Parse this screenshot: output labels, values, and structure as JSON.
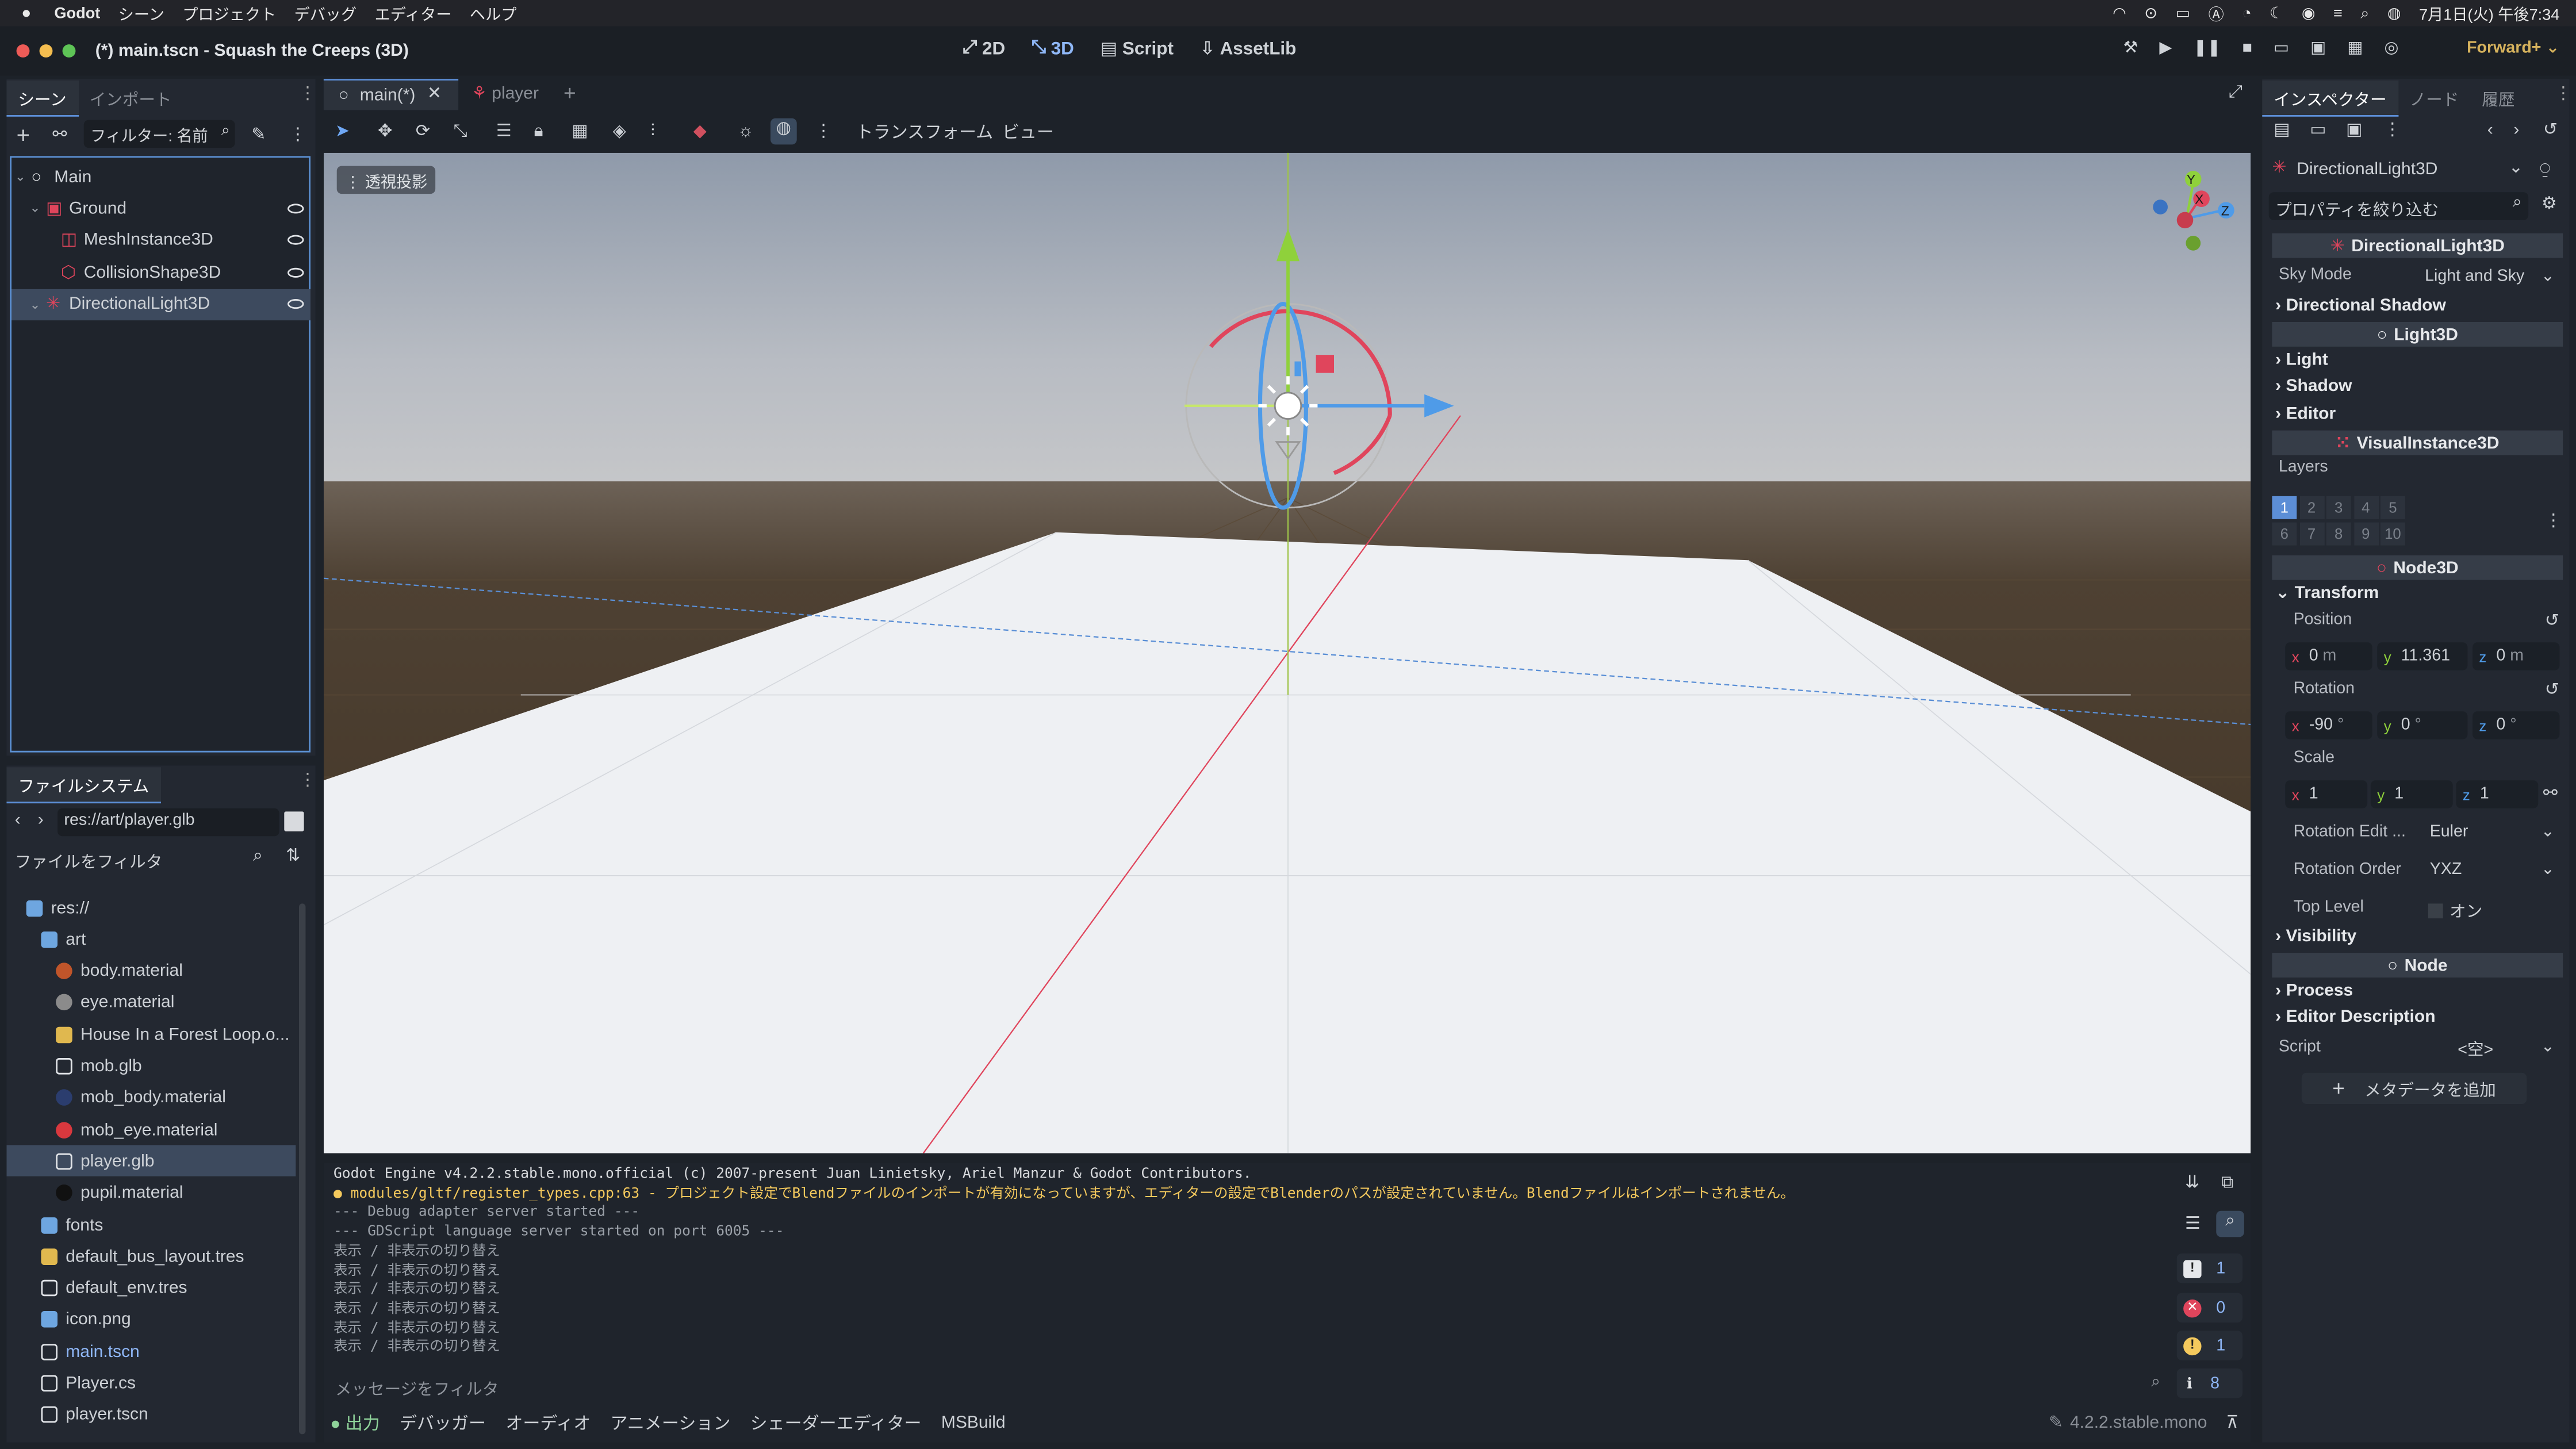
{
  "menubar": {
    "app": "Godot",
    "items": [
      "シーン",
      "プロジェクト",
      "デバッグ",
      "エディター",
      "ヘルプ"
    ],
    "clock": "7月1日(火) 午後7:34"
  },
  "window": {
    "title": "(*) main.tscn - Squash the Creeps (3D)",
    "main_tabs": [
      "2D",
      "3D",
      "Script",
      "AssetLib"
    ],
    "active_main_tab": "3D",
    "renderer": "Forward+"
  },
  "scene_dock": {
    "tabs": [
      "シーン",
      "インポート"
    ],
    "filter_placeholder": "フィルター: 名前",
    "tree": [
      {
        "label": "Main",
        "depth": 0,
        "icon": "node3d-icon"
      },
      {
        "label": "Ground",
        "depth": 1,
        "icon": "staticbody-icon"
      },
      {
        "label": "MeshInstance3D",
        "depth": 2,
        "icon": "mesh-icon"
      },
      {
        "label": "CollisionShape3D",
        "depth": 2,
        "icon": "collision-icon"
      },
      {
        "label": "DirectionalLight3D",
        "depth": 1,
        "icon": "light-icon",
        "selected": true
      }
    ]
  },
  "filesystem": {
    "tab": "ファイルシステム",
    "path": "res://art/player.glb",
    "filter_placeholder": "ファイルをフィルタ",
    "items": [
      {
        "label": "res://",
        "depth": 0,
        "type": "folder"
      },
      {
        "label": "art",
        "depth": 1,
        "type": "folder"
      },
      {
        "label": "body.material",
        "depth": 2,
        "type": "material-dark"
      },
      {
        "label": "eye.material",
        "depth": 2,
        "type": "material-grey"
      },
      {
        "label": "House In a Forest Loop.o...",
        "depth": 2,
        "type": "audio"
      },
      {
        "label": "mob.glb",
        "depth": 2,
        "type": "scene"
      },
      {
        "label": "mob_body.material",
        "depth": 2,
        "type": "material-navy"
      },
      {
        "label": "mob_eye.material",
        "depth": 2,
        "type": "material-red"
      },
      {
        "label": "player.glb",
        "depth": 2,
        "type": "scene",
        "selected": true
      },
      {
        "label": "pupil.material",
        "depth": 2,
        "type": "material-black"
      },
      {
        "label": "fonts",
        "depth": 1,
        "type": "folder"
      },
      {
        "label": "default_bus_layout.tres",
        "depth": 1,
        "type": "bus"
      },
      {
        "label": "default_env.tres",
        "depth": 1,
        "type": "env"
      },
      {
        "label": "icon.png",
        "depth": 1,
        "type": "image"
      },
      {
        "label": "main.tscn",
        "depth": 1,
        "type": "scene",
        "highlight": true
      },
      {
        "label": "Player.cs",
        "depth": 1,
        "type": "csharp"
      },
      {
        "label": "player.tscn",
        "depth": 1,
        "type": "scene"
      }
    ]
  },
  "editor_tabs": [
    "main(*)",
    "player"
  ],
  "viewport": {
    "toolbar_menus": [
      "トランスフォーム",
      "ビュー"
    ],
    "perspective_label": "透視投影",
    "axis_labels": {
      "x": "X",
      "y": "Y",
      "z": "Z"
    }
  },
  "output": {
    "lines": [
      {
        "text": "Godot Engine v4.2.2.stable.mono.official (c) 2007-present Juan Linietsky, Ariel Manzur & Godot Contributors.",
        "kind": "normal"
      },
      {
        "text": "modules/gltf/register_types.cpp:63 - プロジェクト設定でBlendファイルのインポートが有効になっていますが、エディターの設定でBlenderのパスが設定されていません。Blendファイルはインポートされません。",
        "kind": "warning"
      },
      {
        "text": "--- Debug adapter server started ---",
        "kind": "dim"
      },
      {
        "text": "--- GDScript language server started on port 6005 ---",
        "kind": "dim"
      },
      {
        "text": "表示 / 非表示の切り替え",
        "kind": "dim"
      },
      {
        "text": "表示 / 非表示の切り替え",
        "kind": "dim"
      },
      {
        "text": "表示 / 非表示の切り替え",
        "kind": "dim"
      },
      {
        "text": "表示 / 非表示の切り替え",
        "kind": "dim"
      },
      {
        "text": "表示 / 非表示の切り替え",
        "kind": "dim"
      },
      {
        "text": "表示 / 非表示の切り替え",
        "kind": "dim"
      }
    ],
    "filter_placeholder": "メッセージをフィルタ",
    "counts": {
      "messages": "1",
      "errors": "0",
      "warnings": "1",
      "info": "8"
    },
    "bottom_tabs": [
      "出力",
      "デバッガー",
      "オーディオ",
      "アニメーション",
      "シェーダーエディター",
      "MSBuild"
    ],
    "version": "4.2.2.stable.mono"
  },
  "inspector": {
    "tabs": [
      "インスペクター",
      "ノード",
      "履歴"
    ],
    "node_name": "DirectionalLight3D",
    "filter_placeholder": "プロパティを絞り込む",
    "class_header": "DirectionalLight3D",
    "sky_mode_label": "Sky Mode",
    "sky_mode_value": "Light and Sky",
    "directional_shadow": "Directional Shadow",
    "light3d": "Light3D",
    "light": "Light",
    "shadow": "Shadow",
    "editor": "Editor",
    "visual_instance": "VisualInstance3D",
    "layers_label": "Layers",
    "layers": [
      "1",
      "2",
      "3",
      "4",
      "5",
      "6",
      "7",
      "8",
      "9",
      "10"
    ],
    "node3d": "Node3D",
    "transform": "Transform",
    "position_label": "Position",
    "position": {
      "x": "0",
      "y": "11.361",
      "z": "0",
      "unit": "m"
    },
    "rotation_label": "Rotation",
    "rotation": {
      "x": "-90",
      "y": "0",
      "z": "0",
      "unit": "°"
    },
    "scale_label": "Scale",
    "scale": {
      "x": "1",
      "y": "1",
      "z": "1"
    },
    "rotation_edit_label": "Rotation Edit ...",
    "rotation_edit_value": "Euler",
    "rotation_order_label": "Rotation Order",
    "rotation_order_value": "YXZ",
    "top_level_label": "Top Level",
    "top_level_value": "オン",
    "visibility": "Visibility",
    "node": "Node",
    "process": "Process",
    "editor_description": "Editor Description",
    "script_label": "Script",
    "script_value": "<空>",
    "add_metadata": "メタデータを追加"
  },
  "colors": {
    "accent": "#5c8ed6",
    "selection": "#3d4a5e",
    "warning": "#f4c95d",
    "axis_x": "#e0455c",
    "axis_y": "#8fd13b",
    "axis_z": "#4f9be8"
  }
}
